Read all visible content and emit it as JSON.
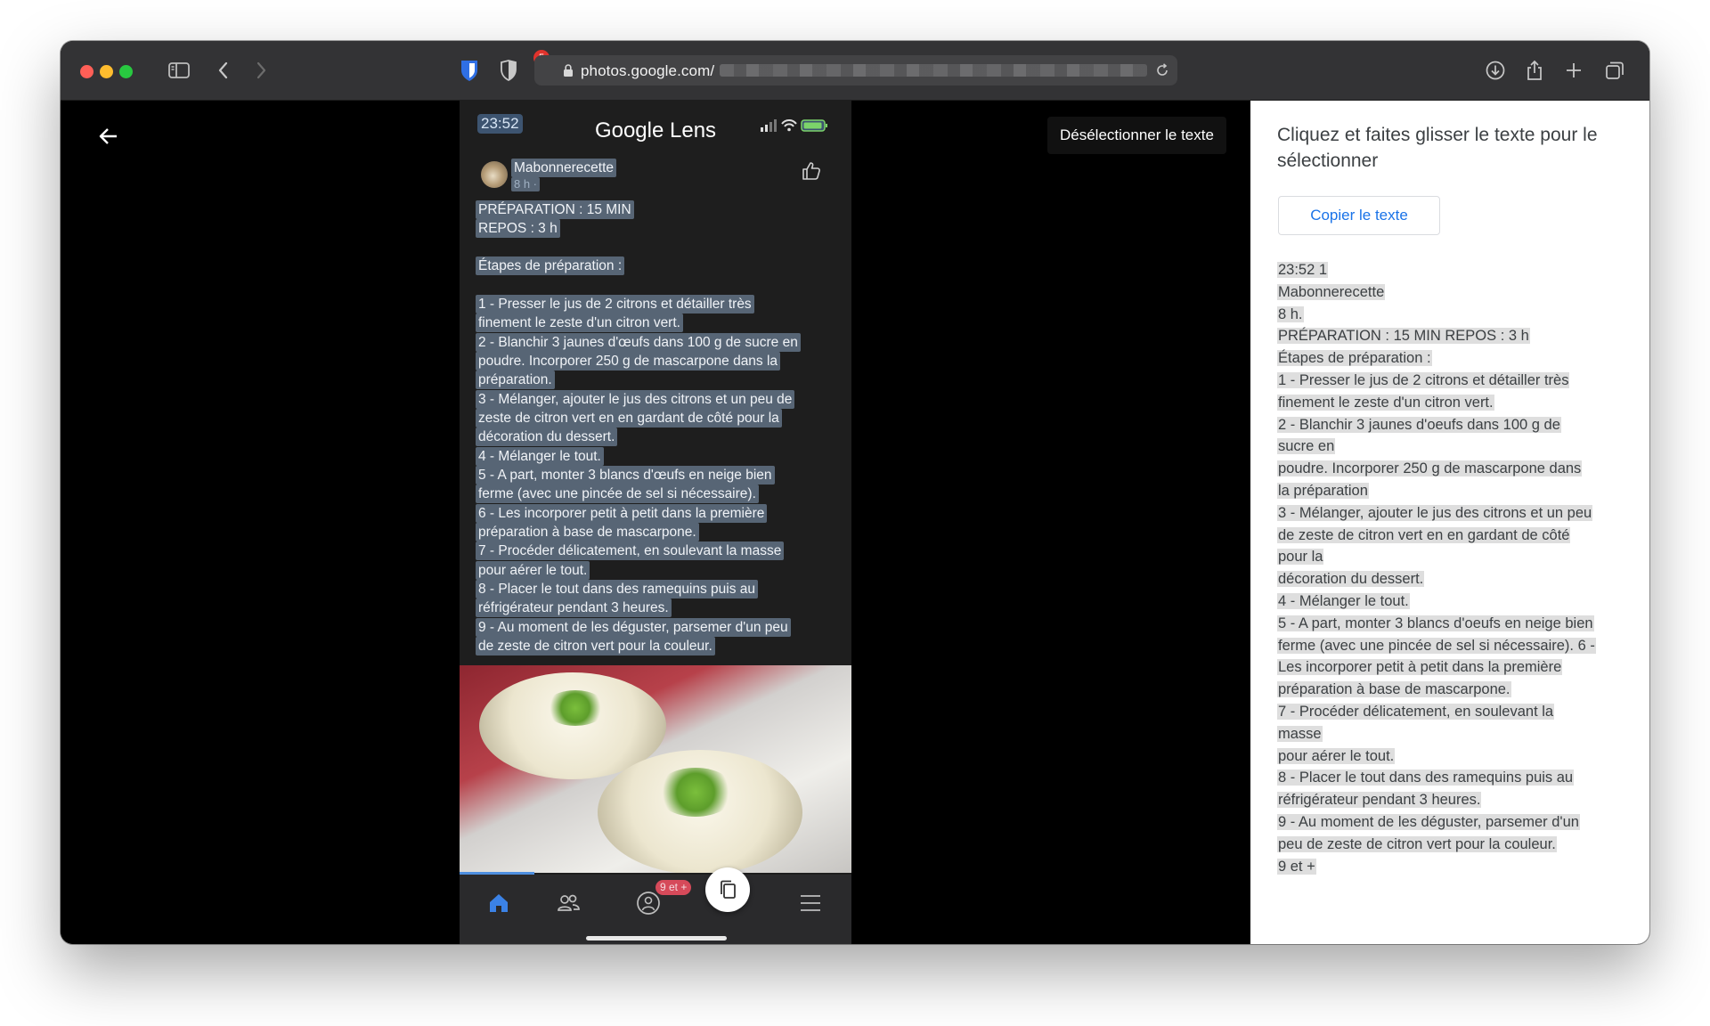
{
  "browser": {
    "url_host": "photos.google.com/",
    "extension_badge": "5"
  },
  "viewer": {
    "deselect_label": "Désélectionner le texte"
  },
  "phone": {
    "time": "23:52",
    "app_title": "Google Lens",
    "author": "Mabonnerecette",
    "post_age": "8 h ·",
    "prep_line1": "PRÉPARATION : 15 MIN",
    "prep_line2": "REPOS : 3 h",
    "steps_heading": "Étapes de préparation :",
    "lines": [
      "1 - Presser le jus de 2 citrons et détailler très",
      "finement le zeste d'un citron vert.",
      "2 - Blanchir 3 jaunes d'œufs dans 100 g de sucre en",
      "poudre. Incorporer 250 g de mascarpone dans la",
      "préparation.",
      "3 - Mélanger, ajouter le jus des citrons et un peu de",
      "zeste de citron vert en en gardant de côté pour la",
      "décoration du dessert.",
      "4 - Mélanger le tout.",
      "5 - A part, monter 3 blancs d'œufs en neige bien",
      "ferme (avec une pincée de sel si nécessaire).",
      "6 - Les incorporer petit à petit dans la première",
      "préparation à base de mascarpone.",
      "7 - Procéder délicatement, en soulevant la masse",
      "pour aérer le tout.",
      "8 - Placer le tout dans des ramequins puis au",
      "réfrigérateur pendant 3 heures.",
      "9 - Au moment de les déguster, parsemer d'un peu",
      "de zeste de citron vert pour la couleur."
    ],
    "nav_badge": "9 et +"
  },
  "panel": {
    "title": "Cliquez et faites glisser le texte pour le sélectionner",
    "copy_button": "Copier le texte",
    "ocr_lines": [
      "23:52 1",
      "Mabonnerecette",
      "8 h.",
      "PRÉPARATION : 15 MIN REPOS : 3 h",
      "Étapes de préparation :",
      "1 - Presser le jus de 2 citrons et détailler très",
      "finement le zeste d'un citron vert.",
      "2 - Blanchir 3 jaunes d'oeufs dans 100 g de",
      "sucre en",
      "poudre. Incorporer 250 g de mascarpone dans",
      "la préparation",
      "3 - Mélanger, ajouter le jus des citrons et un peu",
      "de zeste de citron vert en en gardant de côté",
      "pour la",
      "décoration du dessert.",
      "4 - Mélanger le tout.",
      "5 - A part, monter 3 blancs d'oeufs en neige bien",
      "ferme (avec une pincée de sel si nécessaire). 6 -",
      "Les incorporer petit à petit dans la première",
      "préparation à base de mascarpone.",
      "7 - Procéder délicatement, en soulevant la",
      "masse",
      "pour aérer le tout.",
      "8 - Placer le tout dans des ramequins puis au",
      "réfrigérateur pendant 3 heures.",
      "9 - Au moment de les déguster, parsemer d'un",
      "peu de zeste de citron vert pour la couleur.",
      "9 et +"
    ]
  },
  "colors": {
    "highlight": "#87a0be",
    "link_blue": "#1a73e8",
    "toolbar": "#333335"
  },
  "icons": [
    "sidebar-icon",
    "back-chevron-icon",
    "forward-chevron-icon",
    "bitwarden-shield-icon",
    "privacy-shield-icon",
    "lock-icon",
    "reload-icon",
    "download-icon",
    "share-icon",
    "new-tab-icon",
    "tabs-overview-icon",
    "back-arrow-icon",
    "like-icon",
    "home-icon",
    "friends-icon",
    "groups-icon",
    "copy-icon",
    "menu-icon"
  ]
}
